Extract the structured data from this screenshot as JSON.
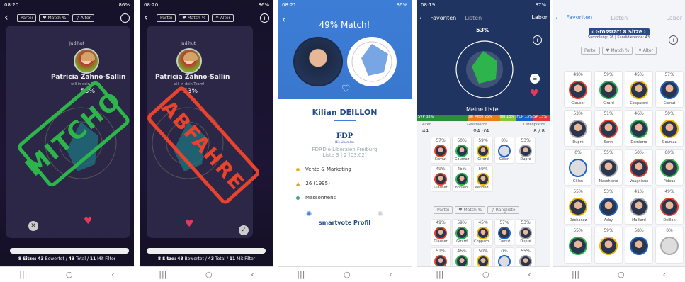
{
  "status": {
    "s1": {
      "time": "08:20",
      "battery": "86%"
    },
    "s2": {
      "time": "08:20",
      "battery": "86%"
    },
    "s3": {
      "time": "08:21",
      "battery": "86%"
    },
    "s4": {
      "time": "08:19",
      "battery": "87%"
    },
    "s5": {
      "time": "",
      "battery": ""
    }
  },
  "swipe": {
    "filters": [
      "Partei",
      "♥ Match %",
      "⚲ Alter"
    ],
    "municipality": "Judihut",
    "name": "Patricia Zahno-Sallin",
    "tagline": "will in dein Team!",
    "match": "53%",
    "stamp_left": "MITCHO",
    "stamp_right": "ABFAHRE",
    "footer": {
      "sitze_label": "8 Sitze:",
      "bewertet": "43",
      "total": "43",
      "filter": "11",
      "bew_label": "Bewertet /",
      "total_label": "Total /",
      "filter_label": "Mit Filter"
    }
  },
  "detail": {
    "match": "49% Match!",
    "name": "Kilian DEILLON",
    "party_logo": "FDP",
    "party_logo_sub": "Die Liberalen",
    "party_line1": "FDP.Die Liberalen Freiburg",
    "party_line2": "Liste 3 | 2 (03.02)",
    "job": "Vente & Marketing",
    "age": "26 (1995)",
    "place": "Massonnens",
    "profile_label": "smartvote Profil"
  },
  "labor": {
    "tabs": [
      "Favoriten",
      "Listen",
      "Labor"
    ],
    "match": "53%",
    "meine_liste": "Meine Liste",
    "party_bar": [
      "SVP 38%",
      "Die Mitte 25%",
      "glp 13%",
      "FDP 13%",
      "SP 13%"
    ],
    "stats": {
      "alter_label": "Alter",
      "alter": "44",
      "geschlecht_label": "Geschlecht",
      "geschlecht": "♀4 ♂4",
      "plaetze_label": "Listenplätze",
      "plaetze": "8 / 8"
    },
    "filters": [
      "Partei",
      "♥ Match %",
      "⚲ Rangliste"
    ],
    "top_cells": [
      {
        "p": "57%",
        "n": "Cornut"
      },
      {
        "p": "50%",
        "n": "Goumaz"
      },
      {
        "p": "59%",
        "n": "Girard"
      },
      {
        "p": "0%",
        "n": "Gillon"
      },
      {
        "p": "53%",
        "n": "Dupré"
      },
      {
        "p": "49%",
        "n": "Glauser"
      },
      {
        "p": "45%",
        "n": "Copparo..."
      },
      {
        "p": "59%",
        "n": "Menoud..."
      }
    ],
    "bottom_cells": [
      {
        "p": "49%",
        "n": "Glauser"
      },
      {
        "p": "59%",
        "n": "Girard"
      },
      {
        "p": "45%",
        "n": "Copparo..."
      },
      {
        "p": "57%",
        "n": "Cornut"
      },
      {
        "p": "53%",
        "n": "Dupré"
      },
      {
        "p": "51%",
        "n": ""
      },
      {
        "p": "46%",
        "n": ""
      },
      {
        "p": "50%",
        "n": ""
      },
      {
        "p": "0%",
        "n": ""
      },
      {
        "p": "55%",
        "n": ""
      }
    ]
  },
  "favoriten": {
    "tabs": [
      "Favoriten",
      "Listen",
      "Labor"
    ],
    "title": "‹ Grossrat: 8 Sitze ›",
    "sub": "Sammlung: 26 | Kandidierende: 43",
    "filters": [
      "Partei",
      "♥ Match %",
      "⚲ Alter"
    ],
    "cells": [
      {
        "p": "49%",
        "n": "Glauser"
      },
      {
        "p": "59%",
        "n": "Girard"
      },
      {
        "p": "45%",
        "n": "Copparoni"
      },
      {
        "p": "57%",
        "n": "Cornut"
      },
      {
        "p": "53%",
        "n": "Dupré"
      },
      {
        "p": "51%",
        "n": "Senn"
      },
      {
        "p": "46%",
        "n": "Demierre"
      },
      {
        "p": "50%",
        "n": "Goumaz"
      },
      {
        "p": "0%",
        "n": "Gillon"
      },
      {
        "p": "55%",
        "n": "Macchione"
      },
      {
        "p": "50%",
        "n": "Vuagniaux"
      },
      {
        "p": "60%",
        "n": "Pidoux"
      },
      {
        "p": "55%",
        "n": "Déchanez"
      },
      {
        "p": "53%",
        "n": "Aeby"
      },
      {
        "p": "41%",
        "n": "Maillard"
      },
      {
        "p": "49%",
        "n": "Deillon"
      },
      {
        "p": "55%",
        "n": ""
      },
      {
        "p": "59%",
        "n": ""
      },
      {
        "p": "58%",
        "n": ""
      },
      {
        "p": "0%",
        "n": ""
      }
    ]
  },
  "colors": {
    "green": "#2db54b",
    "red": "#e8432d",
    "blue": "#3f7fd8",
    "dark": "#1d1535"
  }
}
